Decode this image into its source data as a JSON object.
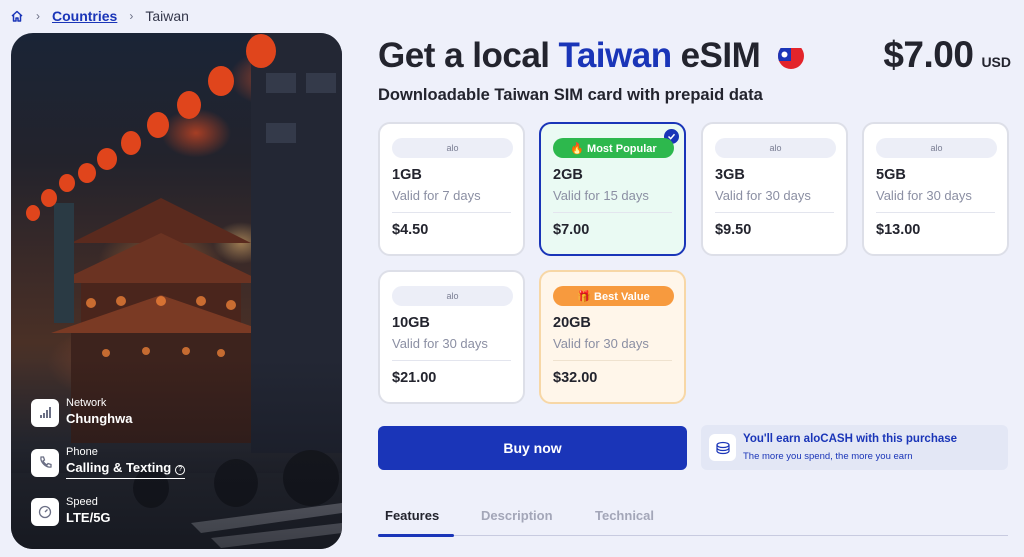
{
  "breadcrumb": {
    "home_icon": "home-icon",
    "link": "Countries",
    "current": "Taiwan"
  },
  "hero": {
    "network": {
      "label": "Network",
      "value": "Chunghwa",
      "icon": "signal-bars-icon"
    },
    "phone": {
      "label": "Phone",
      "value": "Calling & Texting",
      "icon": "phone-icon",
      "info": "?"
    },
    "speed": {
      "label": "Speed",
      "value": "LTE/5G",
      "icon": "speedometer-icon"
    }
  },
  "header": {
    "title_pre": "Get a local",
    "title_country": "Taiwan",
    "title_post": "eSIM",
    "flag_icon": "taiwan-flag-icon",
    "price": "$7.00",
    "currency": "USD",
    "subtitle": "Downloadable Taiwan SIM card with prepaid data"
  },
  "plans": [
    {
      "provider": "alo",
      "data": "1GB",
      "validity": "Valid for 7 days",
      "price": "$4.50"
    },
    {
      "badge": "🔥 Most Popular",
      "data": "2GB",
      "validity": "Valid for 15 days",
      "price": "$7.00",
      "selected": true
    },
    {
      "provider": "alo",
      "data": "3GB",
      "validity": "Valid for 30 days",
      "price": "$9.50"
    },
    {
      "provider": "alo",
      "data": "5GB",
      "validity": "Valid for 30 days",
      "price": "$13.00"
    },
    {
      "provider": "alo",
      "data": "10GB",
      "validity": "Valid for 30 days",
      "price": "$21.00"
    },
    {
      "badge": "🎁 Best Value",
      "data": "20GB",
      "validity": "Valid for 30 days",
      "price": "$32.00"
    }
  ],
  "buy": {
    "label": "Buy now"
  },
  "cash": {
    "title": "You'll earn aloCASH with this purchase",
    "subtitle": "The more you spend, the more you earn",
    "icon": "coins-icon"
  },
  "tabs": [
    {
      "label": "Features",
      "active": true
    },
    {
      "label": "Description"
    },
    {
      "label": "Technical"
    }
  ],
  "colors": {
    "primary": "#1a35b8",
    "popular_badge": "#2db84d",
    "best_badge": "#f79a3e",
    "selected_bg": "#eafaf3",
    "best_bg": "#fff6ea"
  }
}
